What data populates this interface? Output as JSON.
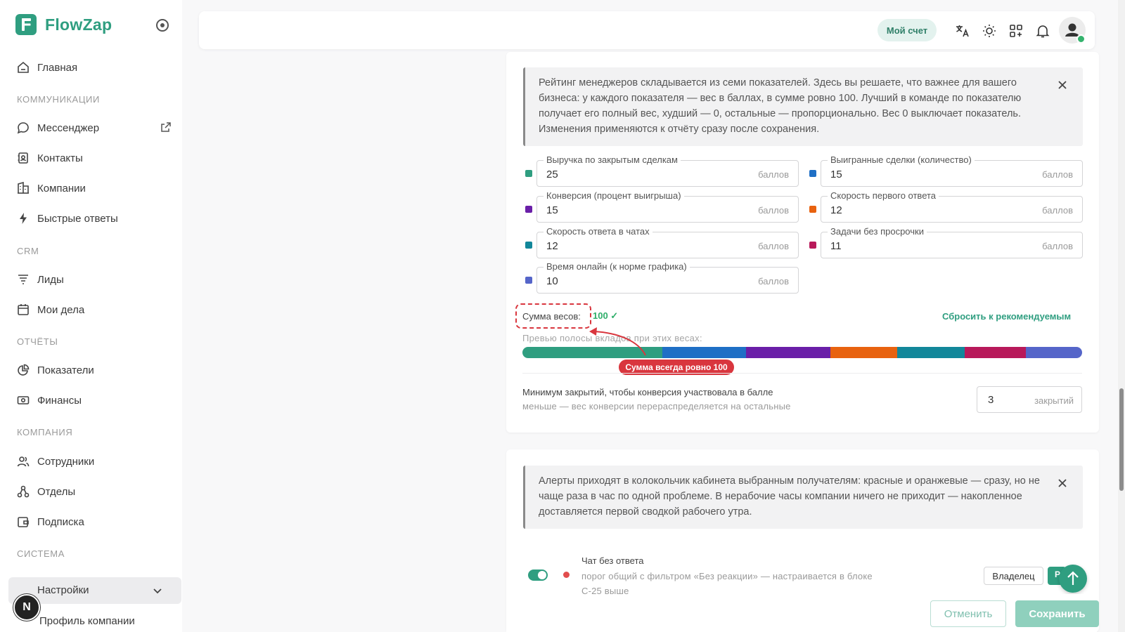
{
  "app": {
    "name": "FlowZap"
  },
  "sidebar": {
    "home": "Главная",
    "sections": {
      "communications": "КОММУНИКАЦИИ",
      "crm": "CRM",
      "reports": "ОТЧЁТЫ",
      "company": "КОМПАНИЯ",
      "system": "СИСТЕМА"
    },
    "items": {
      "messenger": "Мессенджер",
      "contacts": "Контакты",
      "companies": "Компании",
      "quick_replies": "Быстрые ответы",
      "leads": "Лиды",
      "my_tasks": "Мои дела",
      "metrics": "Показатели",
      "finance": "Финансы",
      "employees": "Сотрудники",
      "departments": "Отделы",
      "subscription": "Подписка",
      "settings": "Настройки",
      "company_profile": "Профиль компании"
    },
    "user_badge": "N"
  },
  "topbar": {
    "account_label": "Мой счет"
  },
  "rating": {
    "info": "Рейтинг менеджеров складывается из семи показателей. Здесь вы решаете, что важнее для вашего бизнеса: у каждого показателя — вес в баллах, в сумме ровно 100. Лучший в команде по показателю получает его полный вес, худший — 0, остальные — пропорционально. Вес 0 выключает показатель. Изменения применяются к отчёту сразу после сохранения.",
    "unit": "баллов",
    "fields": [
      {
        "label": "Выручка по закрытым сделкам",
        "value": "25",
        "color": "#2f9e80"
      },
      {
        "label": "Выигранные сделки (количество)",
        "value": "15",
        "color": "#1f6fc5"
      },
      {
        "label": "Конверсия (процент выигрыша)",
        "value": "15",
        "color": "#6a1fa8"
      },
      {
        "label": "Скорость первого ответа",
        "value": "12",
        "color": "#e8620f"
      },
      {
        "label": "Скорость ответа в чатах",
        "value": "12",
        "color": "#12879a"
      },
      {
        "label": "Задачи без просрочки",
        "value": "11",
        "color": "#b8195a"
      },
      {
        "label": "Время онлайн (к норме графика)",
        "value": "10",
        "color": "#5565c9"
      }
    ],
    "sum_label": "Сумма весов:",
    "sum_value": "100 ✓",
    "reset_label": "Сбросить к рекомендуемым",
    "preview_label": "Превью полосы вкладов при этих весах:",
    "callout": "Сумма всегда ровно 100",
    "min_label": "Минимум закрытий, чтобы конверсия участвовала в балле",
    "min_hint": "меньше — вес конверсии перераспределяется на остальные",
    "min_value": "3",
    "min_unit": "закрытий"
  },
  "alerts": {
    "info": "Алерты приходят в колокольчик кабинета выбранным получателям: красные и оранжевые — сразу, но не чаще раза в час по одной проблеме. В нерабочие часы компании ничего не приходит — накопленное доставляется первой сводкой рабочего утра.",
    "item_title": "Чат без ответа",
    "item_desc": "порог общий с фильтром «Без реакции» — настраивается в блоке С-25 выше",
    "owner_chip": "Владелец",
    "r_chip": "Р",
    "toggle_on": true
  },
  "footer": {
    "cancel": "Отменить",
    "save": "Сохранить"
  }
}
